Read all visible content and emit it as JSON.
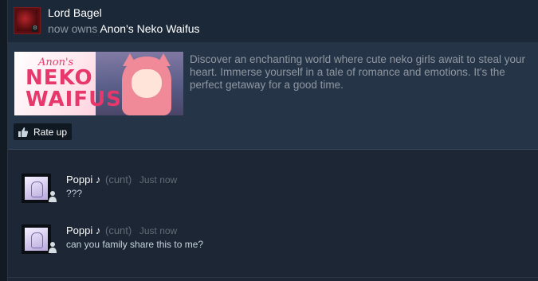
{
  "activity": {
    "user_name": "Lord Bagel",
    "action_text": "now owns",
    "game_title": "Anon's Neko Waifus"
  },
  "game": {
    "banner_logo_top": "Anon's",
    "banner_logo_mid": "NEKO",
    "banner_logo_bottom": "WAIFUS",
    "description": "Discover an enchanting world where cute neko girls await to steal your heart. Immerse yourself in a tale of romance and emotions. It's the perfect getaway for a good time.",
    "rate_label": "Rate up",
    "thumb_icon": "thumbs-up-icon"
  },
  "comments": [
    {
      "author": "Poppi",
      "note_symbol": "♪",
      "nickname": "(cunt)",
      "time": "Just now",
      "text": "???"
    },
    {
      "author": "Poppi",
      "note_symbol": "♪",
      "nickname": "(cunt)",
      "time": "Just now",
      "text": "can you family share this to me?"
    }
  ],
  "colors": {
    "background": "#1d2634",
    "game_panel": "#263448",
    "muted_text": "#8f98a0",
    "accent_pink": "#e8376a"
  }
}
